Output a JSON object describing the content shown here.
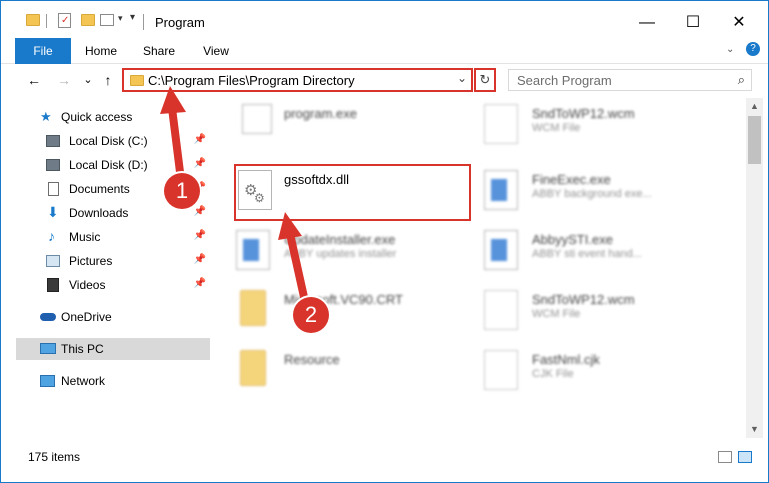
{
  "window": {
    "title": "Program"
  },
  "ribbon": {
    "tabs": [
      "File",
      "Home",
      "Share",
      "View"
    ]
  },
  "address": {
    "path": "C:\\Program Files\\Program Directory",
    "chevron": "⌄",
    "refresh": "↻"
  },
  "search": {
    "placeholder": "Search Program"
  },
  "nav": {
    "back": "←",
    "forward": "→",
    "recent": "⌄",
    "up": "↑"
  },
  "sidebar": {
    "items": [
      {
        "label": "Quick access",
        "icon": "star-icon"
      },
      {
        "label": "Local Disk (C:)",
        "icon": "drive-icon"
      },
      {
        "label": "Local Disk (D:)",
        "icon": "drive-icon"
      },
      {
        "label": "Documents",
        "icon": "documents-icon"
      },
      {
        "label": "Downloads",
        "icon": "download-icon"
      },
      {
        "label": "Music",
        "icon": "music-icon"
      },
      {
        "label": "Pictures",
        "icon": "pictures-icon"
      },
      {
        "label": "Videos",
        "icon": "videos-icon"
      },
      {
        "label": "OneDrive",
        "icon": "cloud-icon"
      },
      {
        "label": "This PC",
        "icon": "computer-icon"
      },
      {
        "label": "Network",
        "icon": "network-icon"
      }
    ]
  },
  "files": [
    {
      "name": "program.exe",
      "type": ""
    },
    {
      "name": "SndToWP12.wcm",
      "type": "WCM File"
    },
    {
      "name": "gssoftdx.dll",
      "type": ""
    },
    {
      "name": "FineExec.exe",
      "type": "ABBY background exe..."
    },
    {
      "name": "UpdateInstaller.exe",
      "type": "ABBY updates installer"
    },
    {
      "name": "AbbyySTI.exe",
      "type": "ABBY sti event hand..."
    },
    {
      "name": "Microsoft.VC90.CRT",
      "type": ""
    },
    {
      "name": "SndToWP12.wcm",
      "type": "WCM File"
    },
    {
      "name": "Resource",
      "type": ""
    },
    {
      "name": "FastNml.cjk",
      "type": "CJK File"
    }
  ],
  "status": {
    "count": "175 items"
  },
  "annotations": {
    "step1": "1",
    "step2": "2"
  },
  "colors": {
    "accent": "#1979ca",
    "highlight": "#d9342b"
  }
}
